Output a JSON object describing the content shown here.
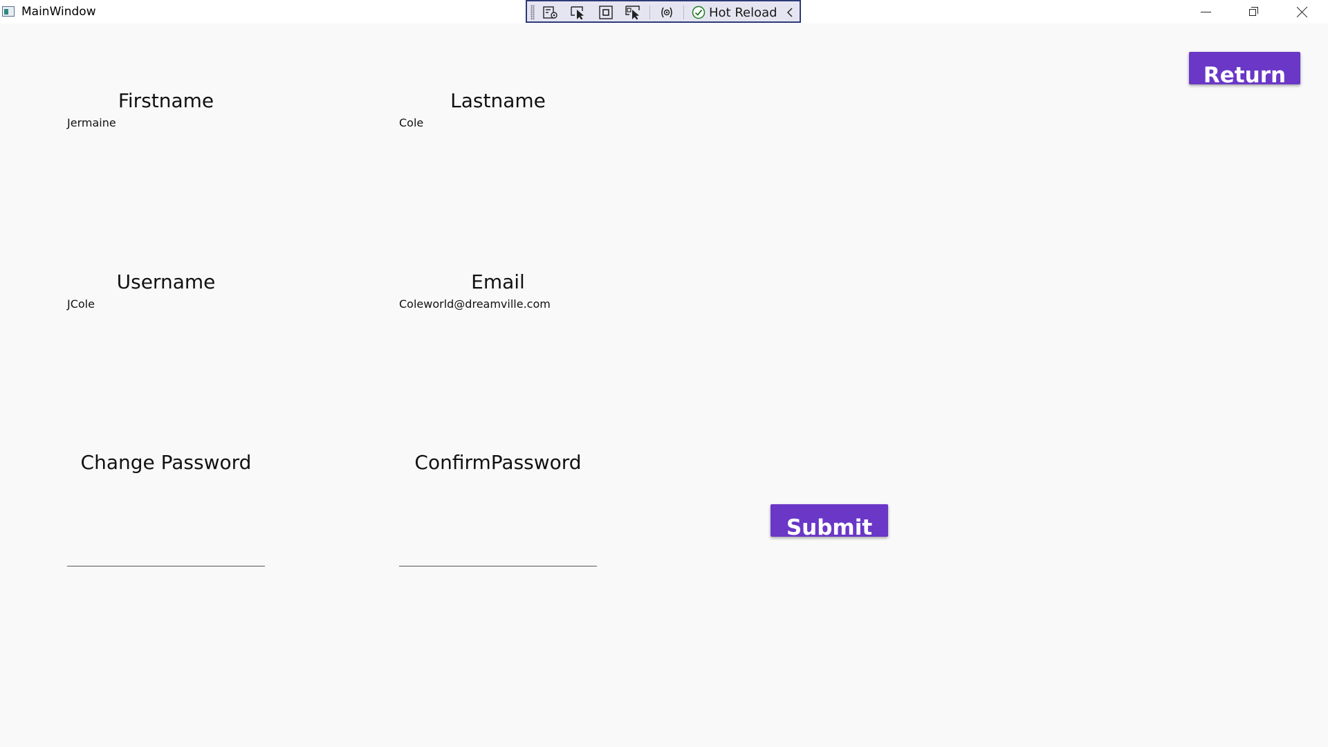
{
  "window": {
    "title": "MainWindow",
    "icon": "wpf-window-icon"
  },
  "debug_toolbar": {
    "hot_reload_label": "Hot Reload",
    "icons": [
      "live-visual-tree-icon",
      "select-element-icon",
      "display-layout-adorners-icon",
      "track-focus-icon",
      "binding-failures-icon",
      "hot-reload-check-icon",
      "collapse-chevron-icon"
    ]
  },
  "header": {
    "return_label": "Return"
  },
  "form": {
    "firstname": {
      "label": "Firstname",
      "value": "Jermaine"
    },
    "lastname": {
      "label": "Lastname",
      "value": "Cole"
    },
    "username": {
      "label": "Username",
      "value": "JCole"
    },
    "email": {
      "label": "Email",
      "value": "Coleworld@dreamville.com"
    },
    "change_password": {
      "label": "Change Password",
      "value": ""
    },
    "confirm_password": {
      "label": "ConfirmPassword",
      "value": ""
    },
    "submit_label": "Submit"
  },
  "colors": {
    "button_background": "#6a37c7",
    "window_background": "#f9f9f9",
    "toolbar_border": "#2b3a77"
  }
}
